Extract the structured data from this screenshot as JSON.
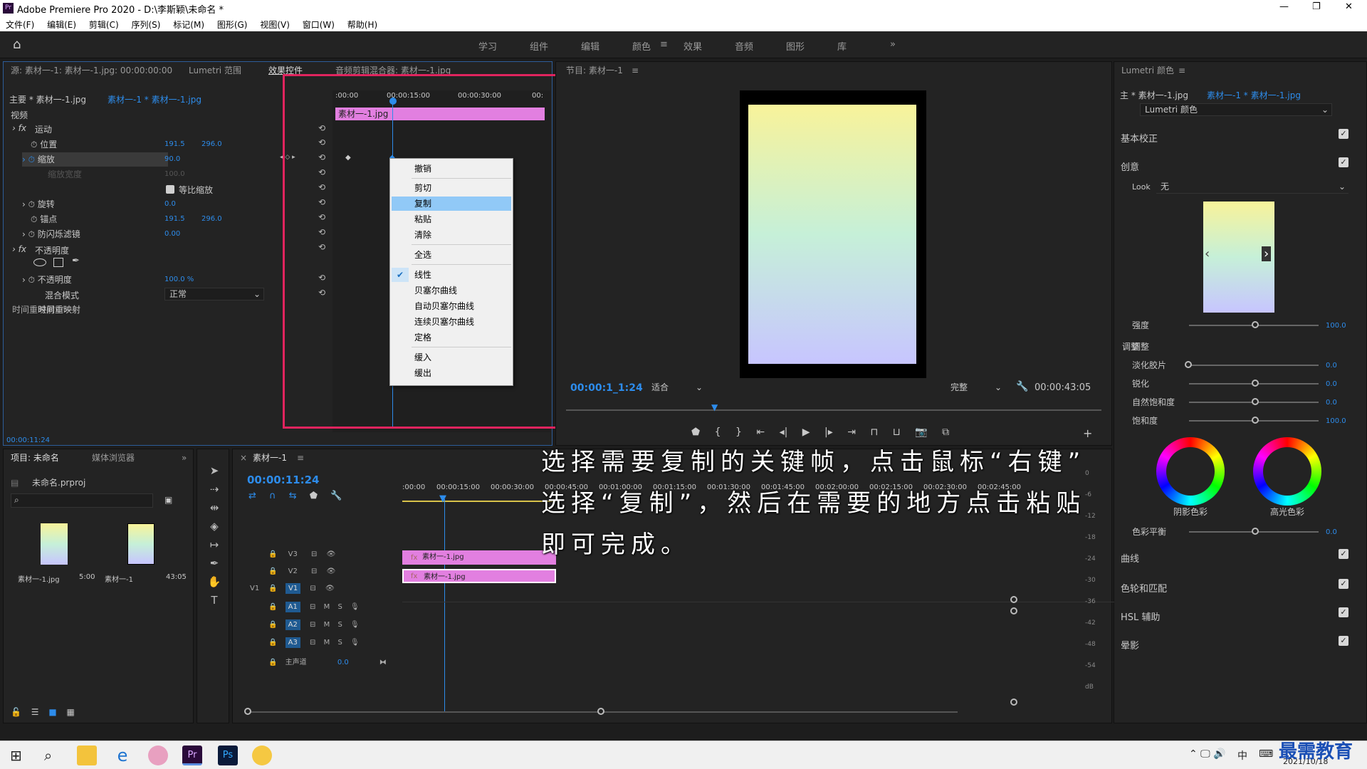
{
  "titlebar": {
    "title": "Adobe Premiere Pro 2020 - D:\\李斯颖\\未命名 *",
    "app_icon": "Pr",
    "controls": [
      "—",
      "❐",
      "✕"
    ]
  },
  "menu": [
    "文件(F)",
    "编辑(E)",
    "剪辑(C)",
    "序列(S)",
    "标记(M)",
    "图形(G)",
    "视图(V)",
    "窗口(W)",
    "帮助(H)"
  ],
  "workspaces": [
    "学习",
    "组件",
    "编辑",
    "颜色",
    "效果",
    "音频",
    "图形",
    "库"
  ],
  "workspace_active": "颜色",
  "source_panel": {
    "tabs": [
      "源: 素材一-1: 素材一-1.jpg: 00:00:00:00",
      "Lumetri 范围",
      "效果控件",
      "音频剪辑混合器: 素材一-1.jpg"
    ],
    "master": "主要 * 素材一-1.jpg",
    "clip": "素材一-1 * 素材一-1.jpg",
    "video_label": "视频",
    "motion": "运动",
    "props": [
      {
        "name": "位置",
        "v1": "191.5",
        "v2": "296.0"
      },
      {
        "name": "缩放",
        "v1": "90.0",
        "v2": ""
      },
      {
        "name": "缩放宽度",
        "v1": "100.0",
        "v2": ""
      },
      {
        "name": "等比缩放",
        "v1": "",
        "v2": ""
      },
      {
        "name": "旋转",
        "v1": "0.0",
        "v2": ""
      },
      {
        "name": "锚点",
        "v1": "191.5",
        "v2": "296.0"
      },
      {
        "name": "防闪烁滤镜",
        "v1": "0.00",
        "v2": ""
      }
    ],
    "opacity": "不透明度",
    "opacity_val": "100.0 %",
    "blend_label": "混合模式",
    "blend_val": "正常",
    "time_remap": "时间重映射",
    "timecode": "00:00:11:24",
    "ruler": [
      ":00:00",
      "00:00:15:00",
      "00:00:30:00",
      "00:"
    ],
    "clip_bar": "素材一-1.jpg"
  },
  "context_menu": {
    "items": [
      "撤销",
      "剪切",
      "复制",
      "粘贴",
      "清除",
      "全选",
      "线性",
      "贝塞尔曲线",
      "自动贝塞尔曲线",
      "连续贝塞尔曲线",
      "定格",
      "缓入",
      "缓出"
    ],
    "highlight": "复制",
    "checked": "线性"
  },
  "program": {
    "title": "节目: 素材一-1",
    "timecode": "00:00:1_1:24",
    "fit": "适合",
    "quality": "完整",
    "duration": "00:00:43:05"
  },
  "lumetri": {
    "title": "Lumetri 颜色",
    "master": "主 * 素材一-1.jpg",
    "clip": "素材一-1 * 素材一-1.jpg",
    "fx": "Lumetri 颜色",
    "basic": "基本校正",
    "creative": "创意",
    "look_label": "Look",
    "look_val": "无",
    "intensity": "强度",
    "intensity_val": "100.0",
    "adjust": "调整",
    "sliders": [
      {
        "name": "淡化胶片",
        "val": "0.0"
      },
      {
        "name": "锐化",
        "val": "0.0"
      },
      {
        "name": "自然饱和度",
        "val": "0.0"
      },
      {
        "name": "饱和度",
        "val": "100.0"
      }
    ],
    "wheel1": "阴影色彩",
    "wheel2": "高光色彩",
    "balance": "色彩平衡",
    "balance_val": "0.0",
    "sections": [
      "曲线",
      "色轮和匹配",
      "HSL 辅助",
      "晕影"
    ]
  },
  "project": {
    "tabs": [
      "项目: 未命名",
      "媒体浏览器"
    ],
    "file": "未命名.prproj",
    "items": [
      {
        "name": "素材一-1.jpg",
        "dur": "5:00"
      },
      {
        "name": "素材一-1",
        "dur": "43:05"
      }
    ]
  },
  "timeline": {
    "title": "素材一-1",
    "timecode": "00:00:11:24",
    "ruler": [
      ":00:00",
      "00:00:15:00",
      "00:00:30:00",
      "00:00:45:00",
      "00:01:00:00",
      "00:01:15:00",
      "00:01:30:00",
      "00:01:45:00",
      "00:02:00:00",
      "00:02:15:00",
      "00:02:30:00",
      "00:02:45:00"
    ],
    "tracks": [
      "V3",
      "V2",
      "V1",
      "A1",
      "A2",
      "A3"
    ],
    "master": "主声道",
    "master_val": "0.0",
    "clips": [
      "素材一-1.jpg",
      "素材一-1.jpg"
    ],
    "meter": [
      "0",
      "-6",
      "-12",
      "-18",
      "-24",
      "-30",
      "-36",
      "-42",
      "-48",
      "-54",
      "dB"
    ]
  },
  "overlay_text": [
    "选择需要复制的关键帧，点击鼠标“右键”",
    "选择“复制”，然后在需要的地方点击粘贴",
    "即可完成。"
  ],
  "taskbar": {
    "ime": "中",
    "date": "2021/10/18",
    "watermark": "最需教育"
  }
}
